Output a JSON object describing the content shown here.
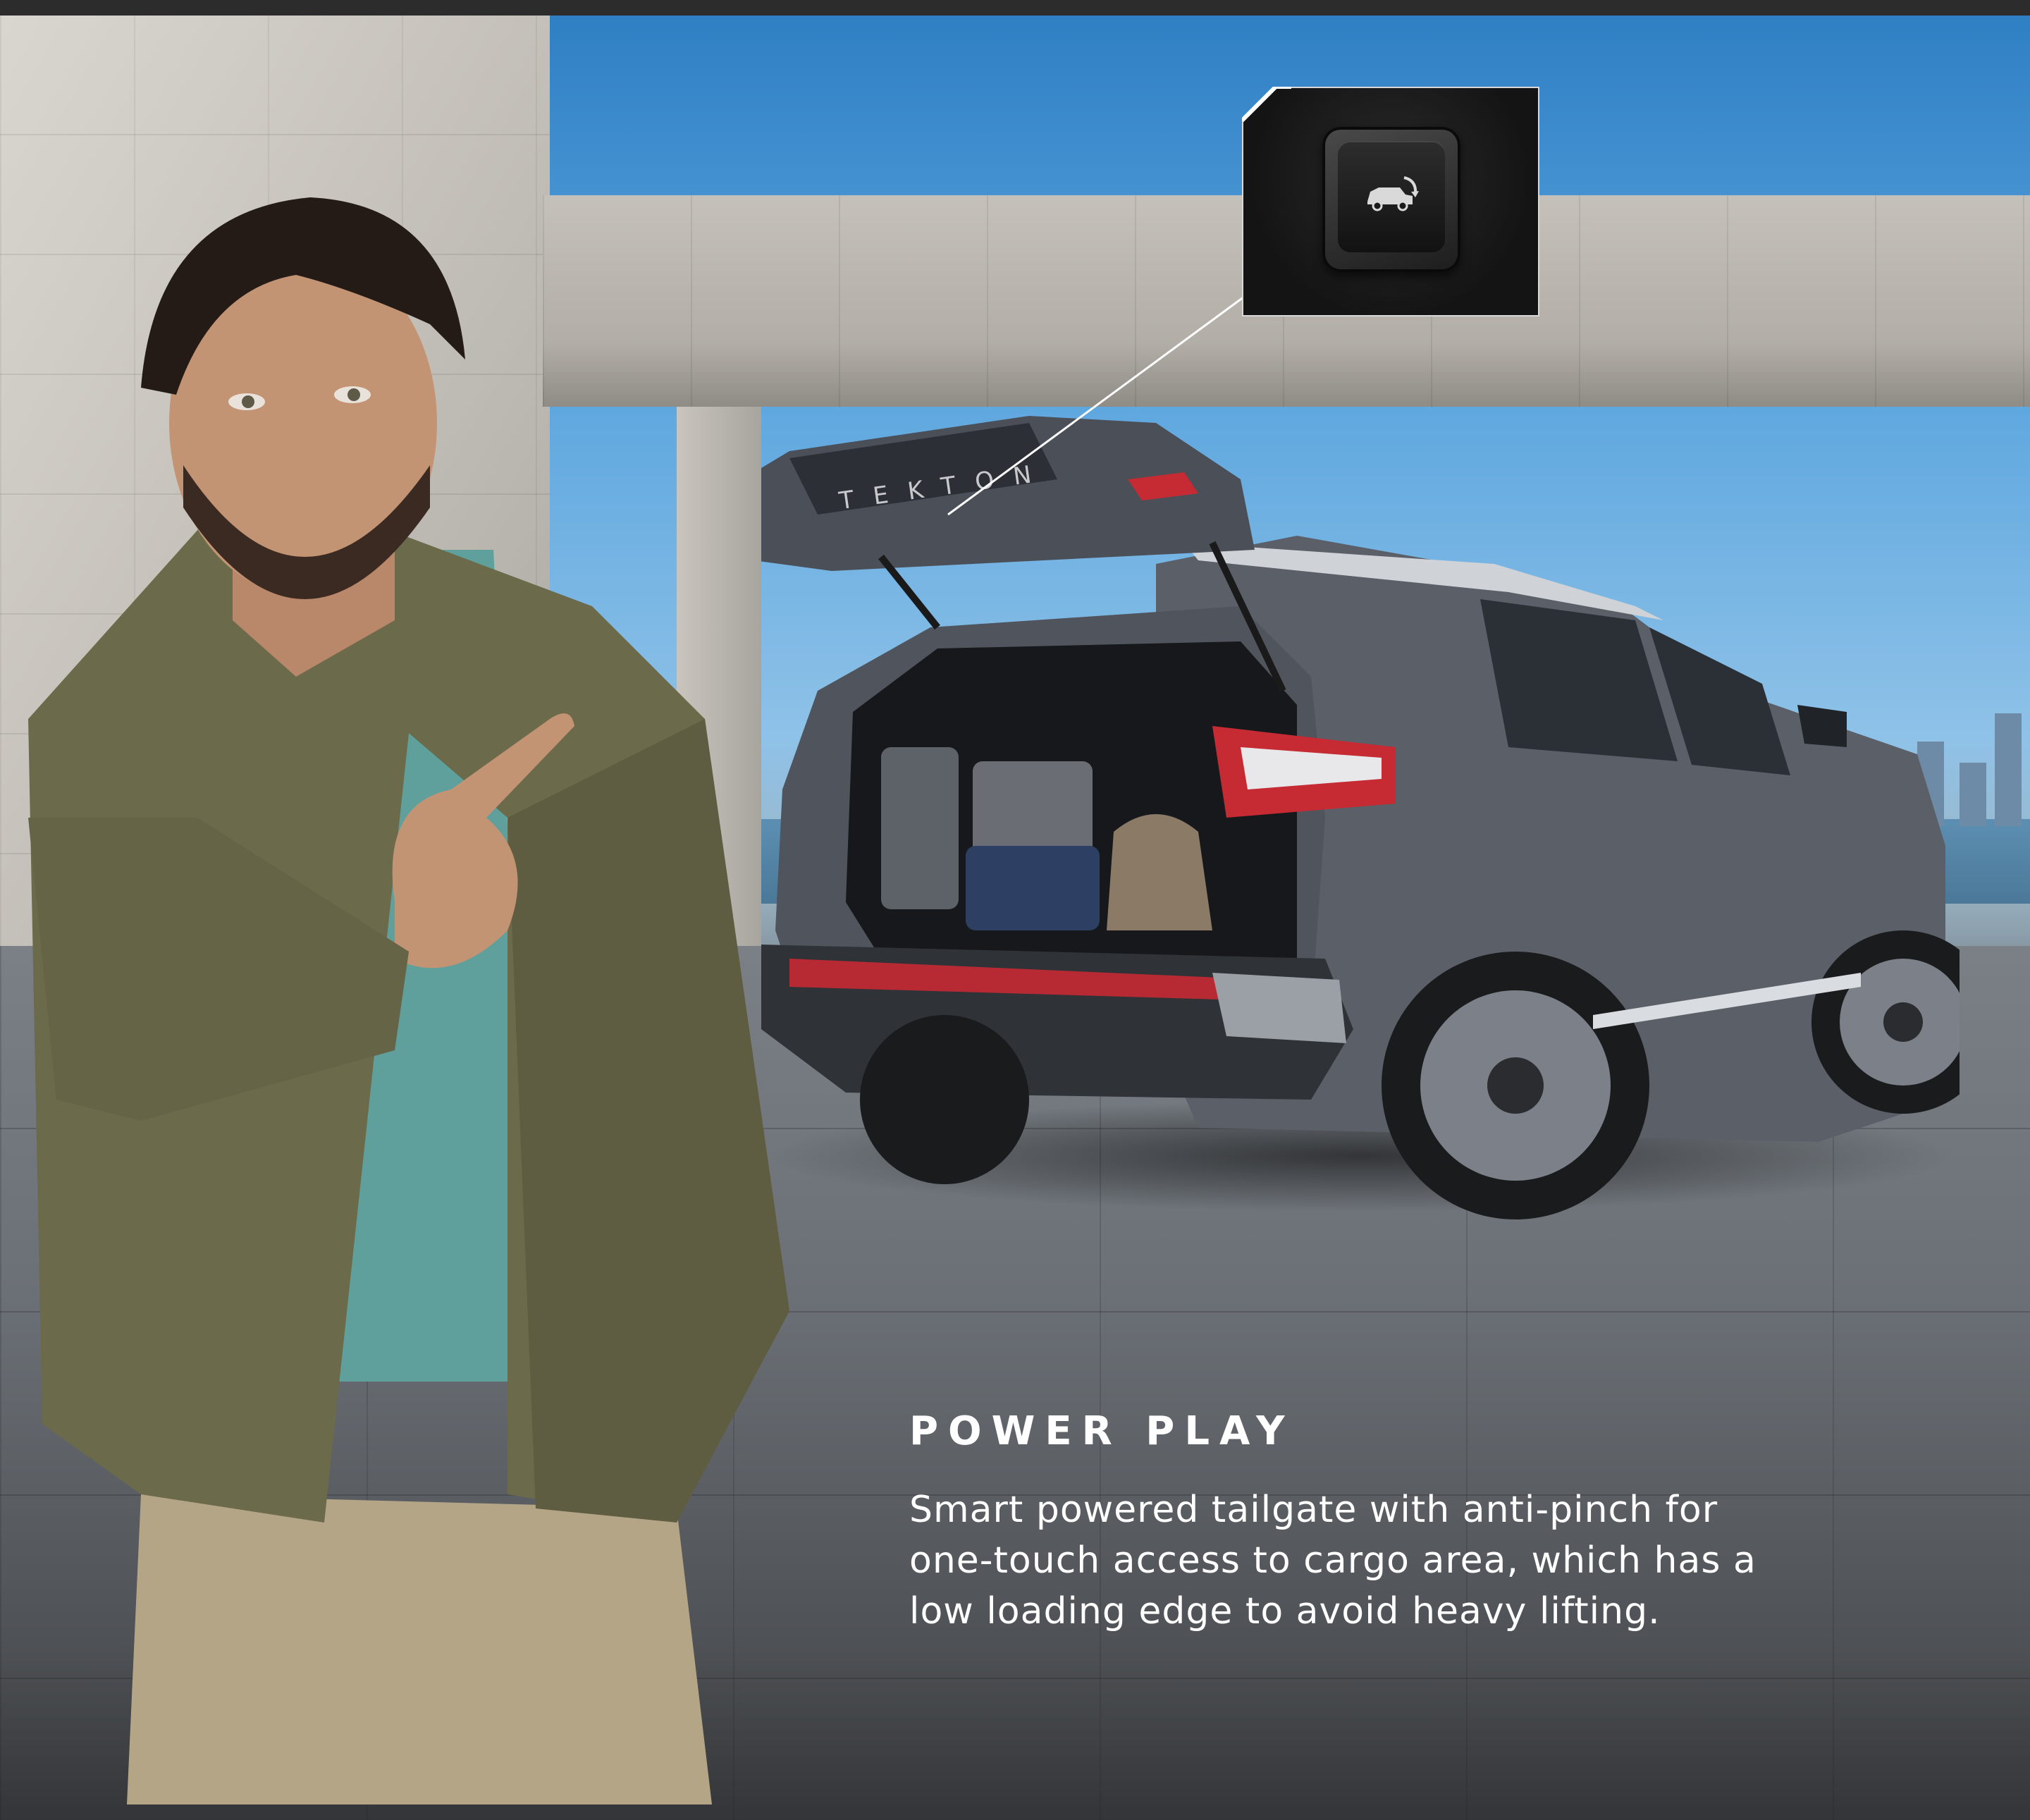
{
  "feature": {
    "heading": "POWER PLAY",
    "body_lines": [
      "Smart powered tailgate with anti-pinch for",
      "one-touch access to cargo area, which has a",
      "low loading edge to avoid heavy lifting."
    ]
  },
  "vehicle": {
    "tailgate_badge": "TEKTON"
  },
  "inset": {
    "switch_icon": "tailgate-open-icon"
  },
  "colors": {
    "text": "#ffffff",
    "vehicle_body": "#5b5f68",
    "sky": "#3f8fd0",
    "inset_border": "#d8d8d8",
    "tail_light": "#c62a33"
  }
}
